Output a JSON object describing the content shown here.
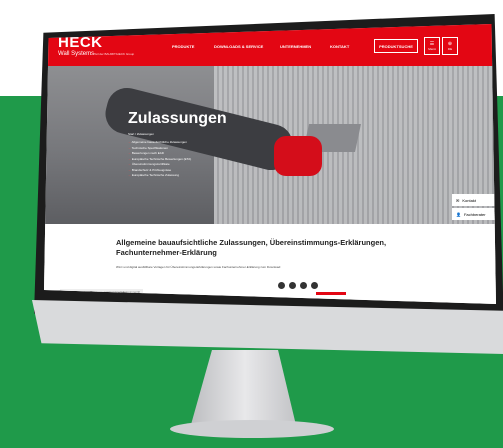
{
  "site": {
    "logo": "HECK",
    "logo_sub": "Wall Systems",
    "logo_tagline": "Teil der BAUMIT/HECK Group"
  },
  "nav": {
    "items": [
      "PRODUKTE",
      "DOWNLOADS & SERVICE",
      "UNTERNEHMEN",
      "KONTAKT"
    ],
    "cta": "PRODUKTSUCHE",
    "icon_labels": [
      "Menü",
      "DE"
    ]
  },
  "hero": {
    "title": "Zulassungen",
    "breadcrumb": "Start / Zulassungen",
    "links": [
      "Allgemeine bauaufsichtliche Zulassungen",
      "Technische Spezifikationen",
      "Bewertungen nach EAD",
      "Europäische Technische Bewertungen (ETA)",
      "Übereinstimmungszertifikate",
      "Brandschutz & Prüfzeugnisse",
      "Europäische Technische Zulassung"
    ],
    "side_tabs": [
      "Kontakt",
      "Fachberater"
    ]
  },
  "content": {
    "headline": "Allgemeine bauaufsichtliche Zulassungen, Übereinstimmungs-Erklärungen, Fachunternehmer-Erklärung",
    "body": "WLC und digital ausfüllbare Vorlagen für Übereinstimmungs-Erklärungen sowie Fachunternehmer-Erklärung zum Download",
    "status_url": "https://www.heck-wallsystems.com/service/zulassungen/#"
  },
  "colors": {
    "brand_red": "#e30613",
    "background_green": "#1f9a4a"
  }
}
